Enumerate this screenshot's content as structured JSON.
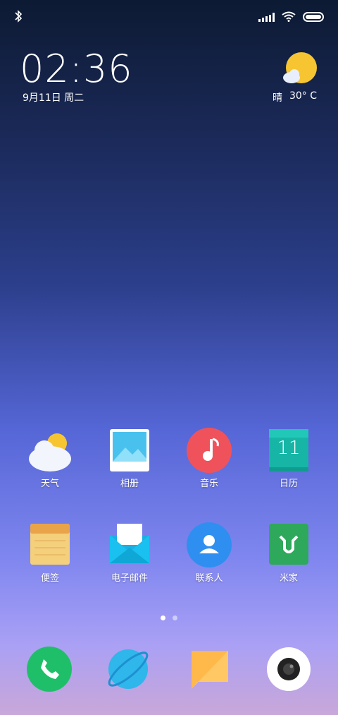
{
  "status_bar": {
    "icons": [
      "bluetooth-icon",
      "signal-icon",
      "wifi-icon",
      "battery-icon"
    ]
  },
  "clock": {
    "time": "02:36",
    "date": "9月11日 周二"
  },
  "weather": {
    "condition": "晴",
    "temperature": "30° C",
    "icon": "partly-sunny-icon"
  },
  "apps": [
    {
      "label": "天气",
      "icon": "weather-icon"
    },
    {
      "label": "相册",
      "icon": "gallery-icon"
    },
    {
      "label": "音乐",
      "icon": "music-icon"
    },
    {
      "label": "日历",
      "icon": "calendar-icon",
      "day": "11"
    },
    {
      "label": "便签",
      "icon": "notes-icon"
    },
    {
      "label": "电子邮件",
      "icon": "email-icon"
    },
    {
      "label": "联系人",
      "icon": "contacts-icon"
    },
    {
      "label": "米家",
      "icon": "mijia-icon"
    }
  ],
  "page_indicator": {
    "current": 1,
    "total": 2
  },
  "dock": [
    {
      "icon": "phone-icon"
    },
    {
      "icon": "browser-icon"
    },
    {
      "icon": "messages-icon"
    },
    {
      "icon": "camera-icon"
    }
  ],
  "colors": {
    "phone": "#1fbf6a",
    "browser": "#2fb6ea",
    "messages": "#ffb84a",
    "music": "#f0525b",
    "calendar": "#17b5a6",
    "mijia": "#2ea85a",
    "contacts": "#2f8ff0",
    "notes": "#f4cf7c"
  }
}
